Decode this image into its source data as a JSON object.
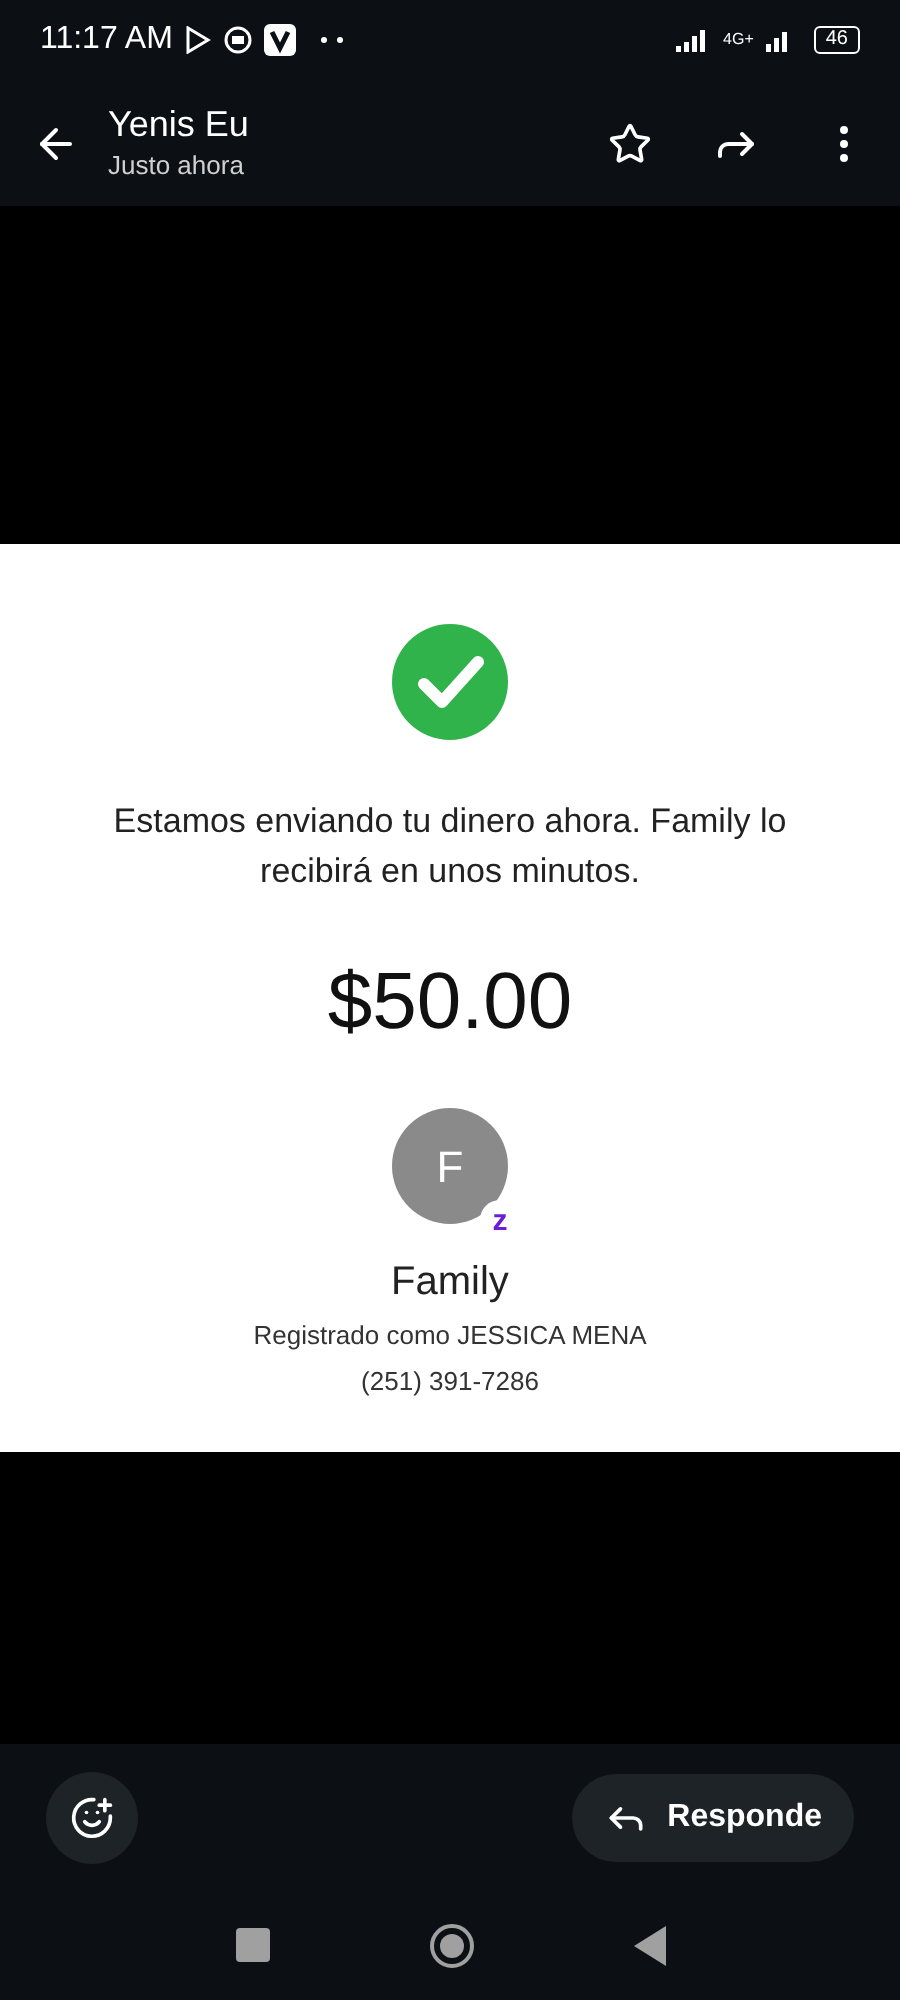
{
  "status_bar": {
    "time": "11:17 AM",
    "network": "4G+",
    "battery": "46"
  },
  "header": {
    "title": "Yenis Eu",
    "subtitle": "Justo ahora"
  },
  "receipt": {
    "message": "Estamos enviando tu dinero ahora. Family lo recibirá en unos minutos.",
    "amount": "$50.00",
    "avatar_initial": "F",
    "badge": "z",
    "recipient": "Family",
    "registered": "Registrado como JESSICA MENA",
    "phone": "(251) 391-7286"
  },
  "reply_button": {
    "label": "Responde"
  }
}
